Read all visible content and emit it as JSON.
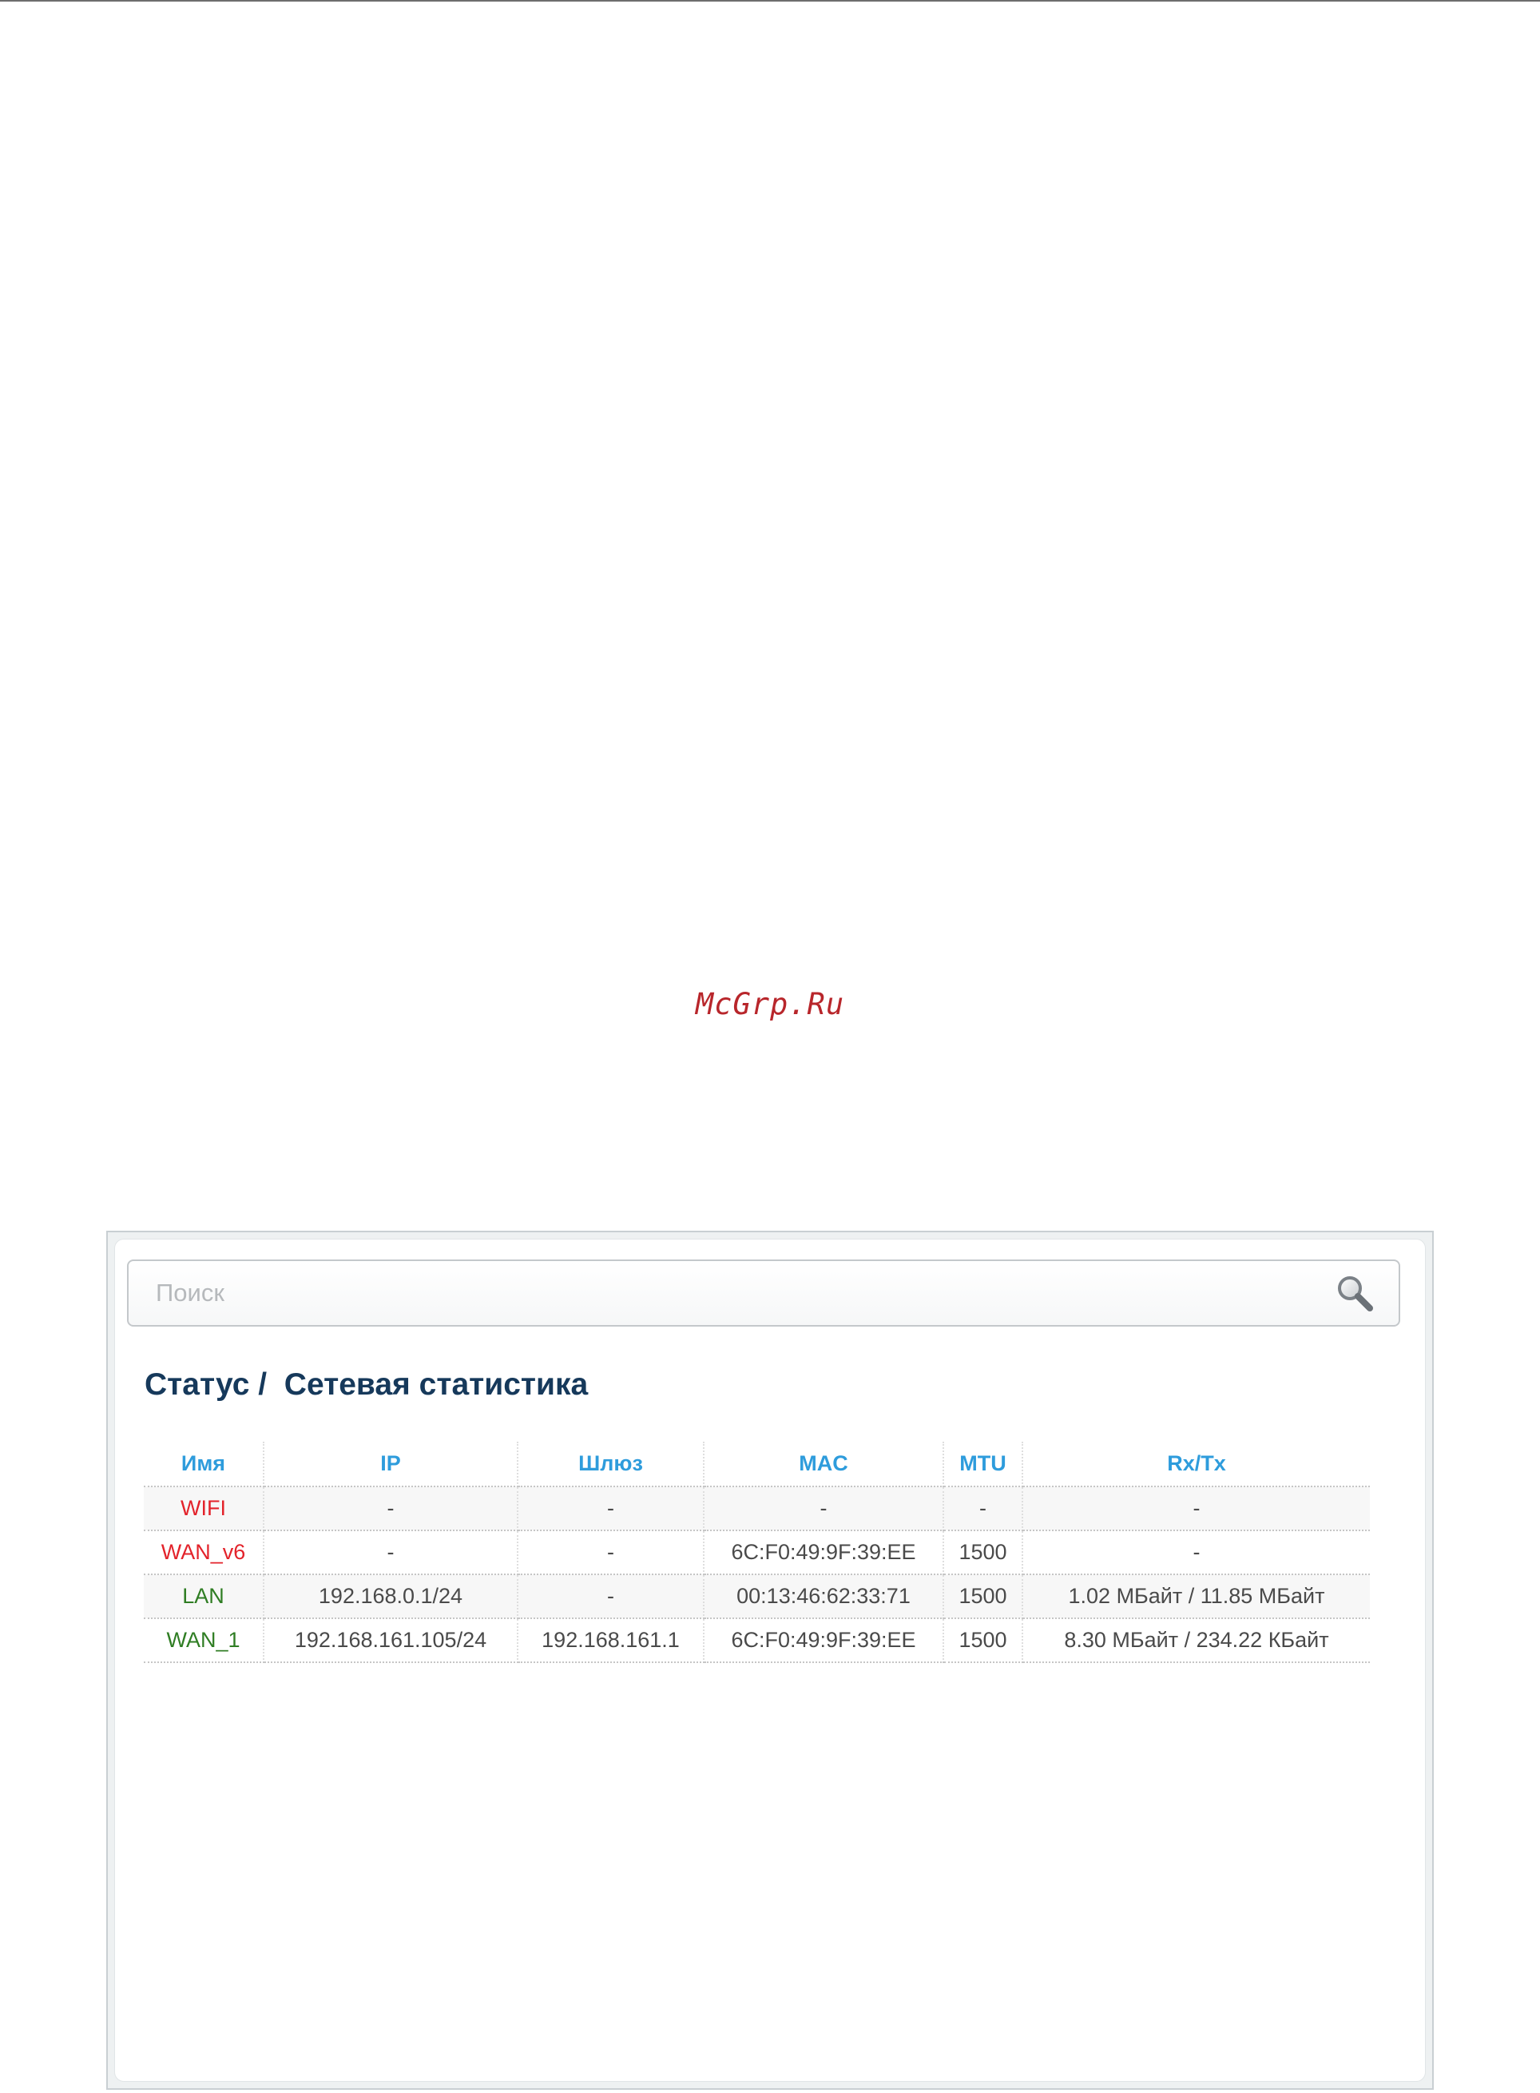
{
  "watermark": "McGrp.Ru",
  "search": {
    "placeholder": "Поиск",
    "icon": "search-icon"
  },
  "breadcrumb": {
    "text": "Статус /  Сетевая статистика"
  },
  "table": {
    "columns": [
      "Имя",
      "IP",
      "Шлюз",
      "MAC",
      "MTU",
      "Rx/Tx"
    ],
    "rows": [
      {
        "name": "WIFI",
        "ip": "-",
        "gateway": "-",
        "mac": "-",
        "mtu": "-",
        "rxtx": "-",
        "status": "down"
      },
      {
        "name": "WAN_v6",
        "ip": "-",
        "gateway": "-",
        "mac": "6C:F0:49:9F:39:EE",
        "mtu": "1500",
        "rxtx": "-",
        "status": "down"
      },
      {
        "name": "LAN",
        "ip": "192.168.0.1/24",
        "gateway": "-",
        "mac": "00:13:46:62:33:71",
        "mtu": "1500",
        "rxtx": "1.02 МБайт / 11.85 МБайт",
        "status": "up"
      },
      {
        "name": "WAN_1",
        "ip": "192.168.161.105/24",
        "gateway": "192.168.161.1",
        "mac": "6C:F0:49:9F:39:EE",
        "mtu": "1500",
        "rxtx": "8.30 МБайт / 234.22 КБайт",
        "status": "up"
      }
    ]
  },
  "colors": {
    "title": "#16395b",
    "header": "#2e9cdc",
    "status_down": "#e3232b",
    "status_up": "#2f7d23"
  }
}
